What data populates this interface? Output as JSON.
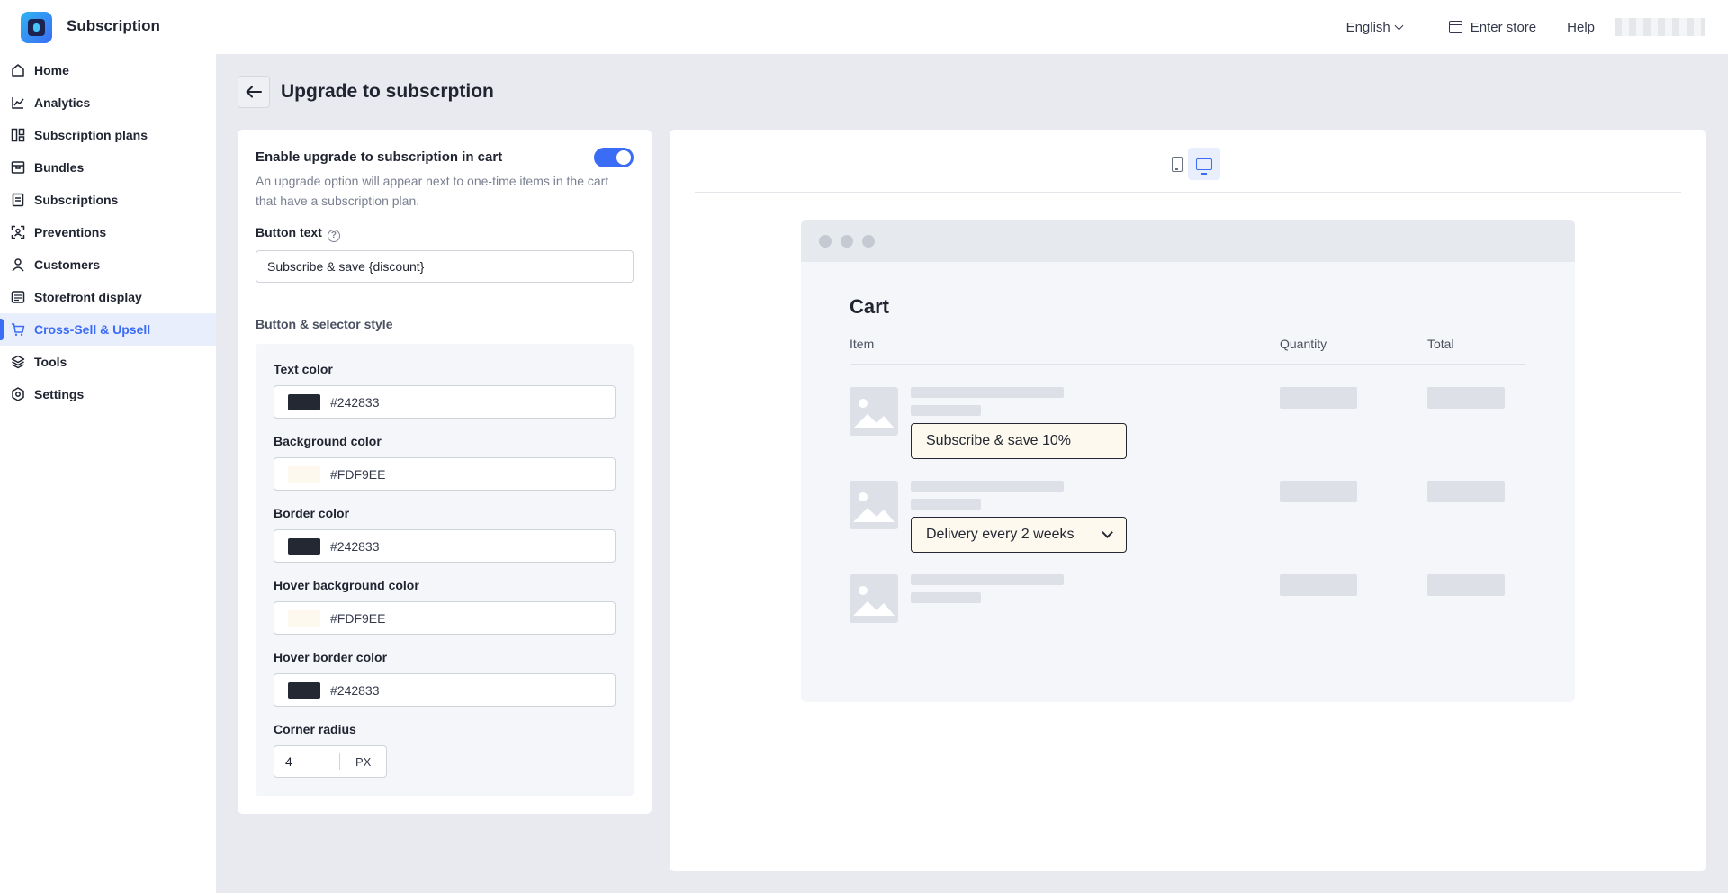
{
  "app": {
    "title": "Subscription"
  },
  "topbar": {
    "language": "English",
    "enter_store": "Enter store",
    "help": "Help"
  },
  "sidebar": {
    "items": [
      {
        "label": "Home",
        "icon": "home-icon"
      },
      {
        "label": "Analytics",
        "icon": "analytics-icon"
      },
      {
        "label": "Subscription plans",
        "icon": "plans-icon"
      },
      {
        "label": "Bundles",
        "icon": "bundles-icon"
      },
      {
        "label": "Subscriptions",
        "icon": "subscriptions-icon"
      },
      {
        "label": "Preventions",
        "icon": "preventions-icon"
      },
      {
        "label": "Customers",
        "icon": "customers-icon"
      },
      {
        "label": "Storefront display",
        "icon": "storefront-icon"
      },
      {
        "label": "Cross-Sell & Upsell",
        "icon": "cart-icon",
        "active": true
      },
      {
        "label": "Tools",
        "icon": "layers-icon"
      },
      {
        "label": "Settings",
        "icon": "settings-icon"
      }
    ]
  },
  "page": {
    "title": "Upgrade to subscrption"
  },
  "settings": {
    "toggle_label": "Enable upgrade to subscription in cart",
    "toggle_on": true,
    "toggle_description": "An upgrade option will appear next to one-time items in the cart that have a subscription plan.",
    "button_text_label": "Button text",
    "button_text_value": "Subscribe & save {discount}",
    "style_section_label": "Button & selector style",
    "colors": [
      {
        "label": "Text color",
        "value": "#242833"
      },
      {
        "label": "Background color",
        "value": "#FDF9EE"
      },
      {
        "label": "Border color",
        "value": "#242833"
      },
      {
        "label": "Hover background color",
        "value": "#FDF9EE"
      },
      {
        "label": "Hover border color",
        "value": "#242833"
      }
    ],
    "corner_radius_label": "Corner radius",
    "corner_radius_value": "4",
    "corner_radius_unit": "PX"
  },
  "preview": {
    "device_selected": "desktop",
    "cart_title": "Cart",
    "columns": {
      "item": "Item",
      "quantity": "Quantity",
      "total": "Total"
    },
    "subscribe_button": "Subscribe & save 10%",
    "delivery_selector": "Delivery every 2 weeks"
  },
  "theme": {
    "accent": "#3B6CF6",
    "text": "#242833",
    "button_bg": "#FDF9EE"
  }
}
